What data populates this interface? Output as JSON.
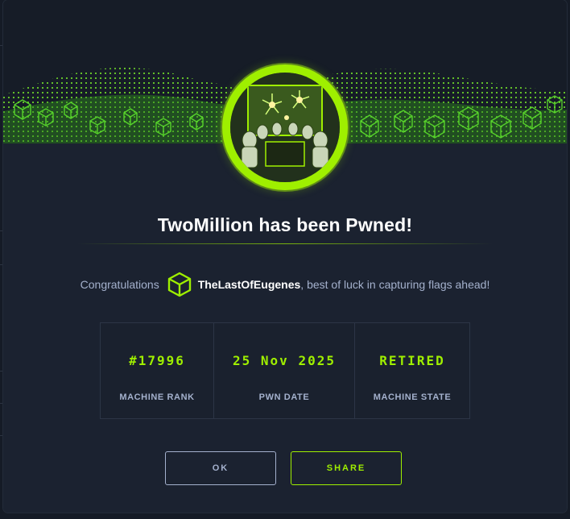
{
  "modal": {
    "title": "TwoMillion has been Pwned!",
    "congrats_lead": "Congratulations",
    "username": "TheLastOfEugenes",
    "congrats_tail": ", best of luck in capturing flags ahead!"
  },
  "stats": [
    {
      "value": "#17996",
      "label": "MACHINE RANK"
    },
    {
      "value": "25 Nov 2025",
      "label": "PWN DATE"
    },
    {
      "value": "RETIRED",
      "label": "MACHINE STATE"
    }
  ],
  "buttons": {
    "ok_label": "OK",
    "share_label": "SHARE"
  },
  "icons": {
    "user": "cube-icon",
    "avatar": "machine-avatar-fireworks"
  },
  "colors": {
    "accent": "#9fef00",
    "panel": "#1b2230",
    "muted_text": "#a4b1cd",
    "title_text": "#ffffff"
  }
}
